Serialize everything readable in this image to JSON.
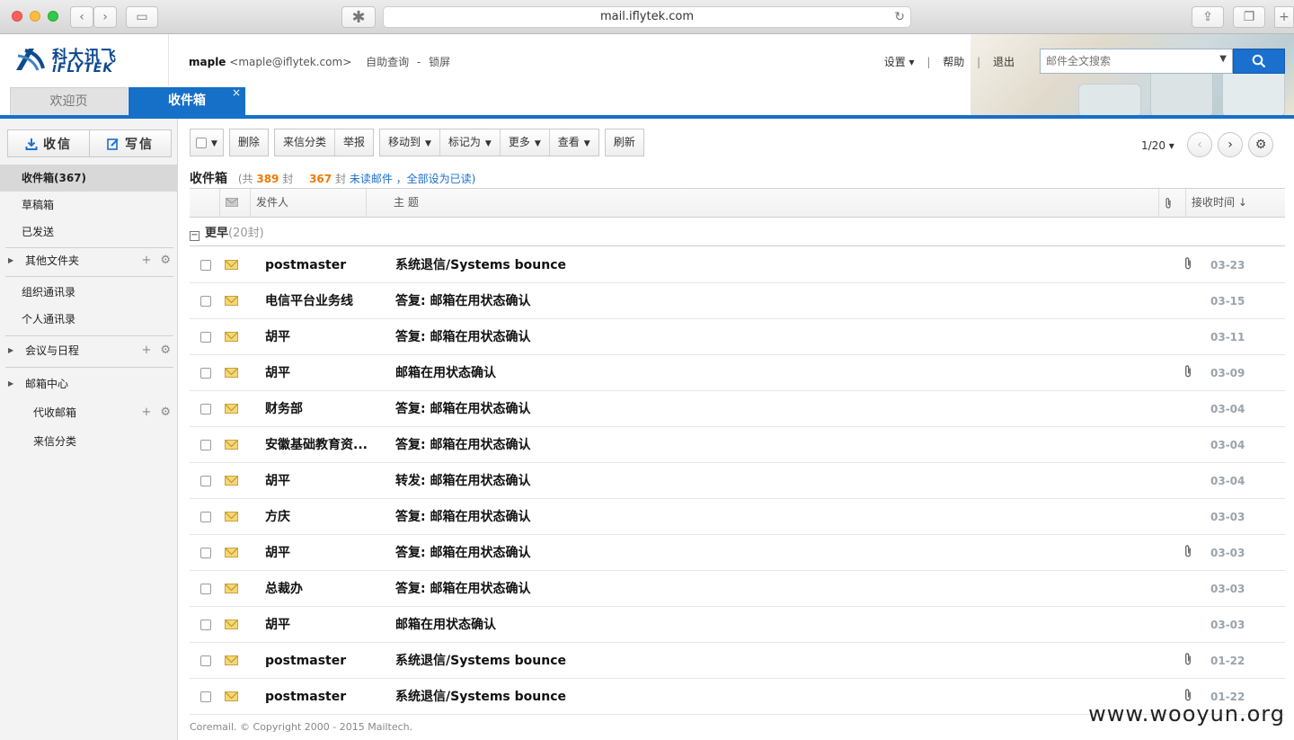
{
  "browser": {
    "url": "mail.iflytek.com"
  },
  "brand": {
    "name_cn": "科大讯飞",
    "name_en": "iFLYTEK",
    "accent_color": "#1670c8"
  },
  "userbar": {
    "username": "maple",
    "email": "<maple@iflytek.com>",
    "self_service": "自助查询",
    "dash": "-",
    "lock": "锁屏"
  },
  "toplinks": {
    "settings": "设置 ▾",
    "sep": "|",
    "help": "帮助",
    "logout": "退出"
  },
  "search": {
    "placeholder": "邮件全文搜索",
    "icon": "search-icon"
  },
  "tabs": [
    {
      "label": "欢迎页",
      "active": false
    },
    {
      "label": "收件箱",
      "active": true,
      "close": "×"
    }
  ],
  "sidebar": {
    "receive": "收信",
    "compose": "写信",
    "folders": [
      {
        "label": "收件箱(367)",
        "active": true
      },
      {
        "label": "草稿箱"
      },
      {
        "label": "已发送"
      },
      {
        "label": "其他文件夹",
        "expandable": true,
        "tools": true
      },
      {
        "label": "组织通讯录"
      },
      {
        "label": "个人通讯录"
      },
      {
        "label": "会议与日程",
        "expandable": true,
        "tools": true
      },
      {
        "label": "邮箱中心",
        "expandable": true
      },
      {
        "label": "代收邮箱",
        "tools": true
      },
      {
        "label": "来信分类"
      }
    ],
    "tool_add": "+",
    "tool_gear": "⚙"
  },
  "toolbar": {
    "delete": "删除",
    "classify": "来信分类",
    "report": "举报",
    "move_to": "移动到",
    "mark_as": "标记为",
    "more": "更多",
    "view": "查看",
    "refresh": "刷新",
    "pager": "1/20 ▾"
  },
  "summary": {
    "title": "收件箱",
    "prefix": "(共",
    "total": "389",
    "unit": "封",
    "unread": "367",
    "unit2": "封",
    "unread_link": "未读邮件",
    "mark_all": "，全部设为已读",
    "suffix": ")"
  },
  "columns": {
    "sender": "发件人",
    "subject": "主  题",
    "received": "接收时间 ↓"
  },
  "group": {
    "toggle": "−",
    "label": "更早",
    "count": "(20封)"
  },
  "emails": [
    {
      "sender": "postmaster",
      "subject": "系统退信/Systems bounce",
      "attachment": true,
      "date": "03-23"
    },
    {
      "sender": "电信平台业务线",
      "subject": "答复: 邮箱在用状态确认",
      "attachment": false,
      "date": "03-15"
    },
    {
      "sender": "胡平",
      "subject": "答复: 邮箱在用状态确认",
      "attachment": false,
      "date": "03-11"
    },
    {
      "sender": "胡平",
      "subject": "邮箱在用状态确认",
      "attachment": true,
      "date": "03-09"
    },
    {
      "sender": "财务部",
      "subject": "答复: 邮箱在用状态确认",
      "attachment": false,
      "date": "03-04"
    },
    {
      "sender": "安徽基础教育资...",
      "subject": "答复: 邮箱在用状态确认",
      "attachment": false,
      "date": "03-04"
    },
    {
      "sender": "胡平",
      "subject": "转发: 邮箱在用状态确认",
      "attachment": false,
      "date": "03-04"
    },
    {
      "sender": "方庆",
      "subject": "答复: 邮箱在用状态确认",
      "attachment": false,
      "date": "03-03"
    },
    {
      "sender": "胡平",
      "subject": "答复: 邮箱在用状态确认",
      "attachment": true,
      "date": "03-03"
    },
    {
      "sender": "总裁办",
      "subject": "答复: 邮箱在用状态确认",
      "attachment": false,
      "date": "03-03"
    },
    {
      "sender": "胡平",
      "subject": "邮箱在用状态确认",
      "attachment": false,
      "date": "03-03"
    },
    {
      "sender": "postmaster",
      "subject": "系统退信/Systems bounce",
      "attachment": true,
      "date": "01-22"
    },
    {
      "sender": "postmaster",
      "subject": "系统退信/Systems bounce",
      "attachment": true,
      "date": "01-22"
    }
  ],
  "footer": "Coremail. © Copyright 2000 - 2015 Mailtech.",
  "watermark": "www.wooyun.org"
}
